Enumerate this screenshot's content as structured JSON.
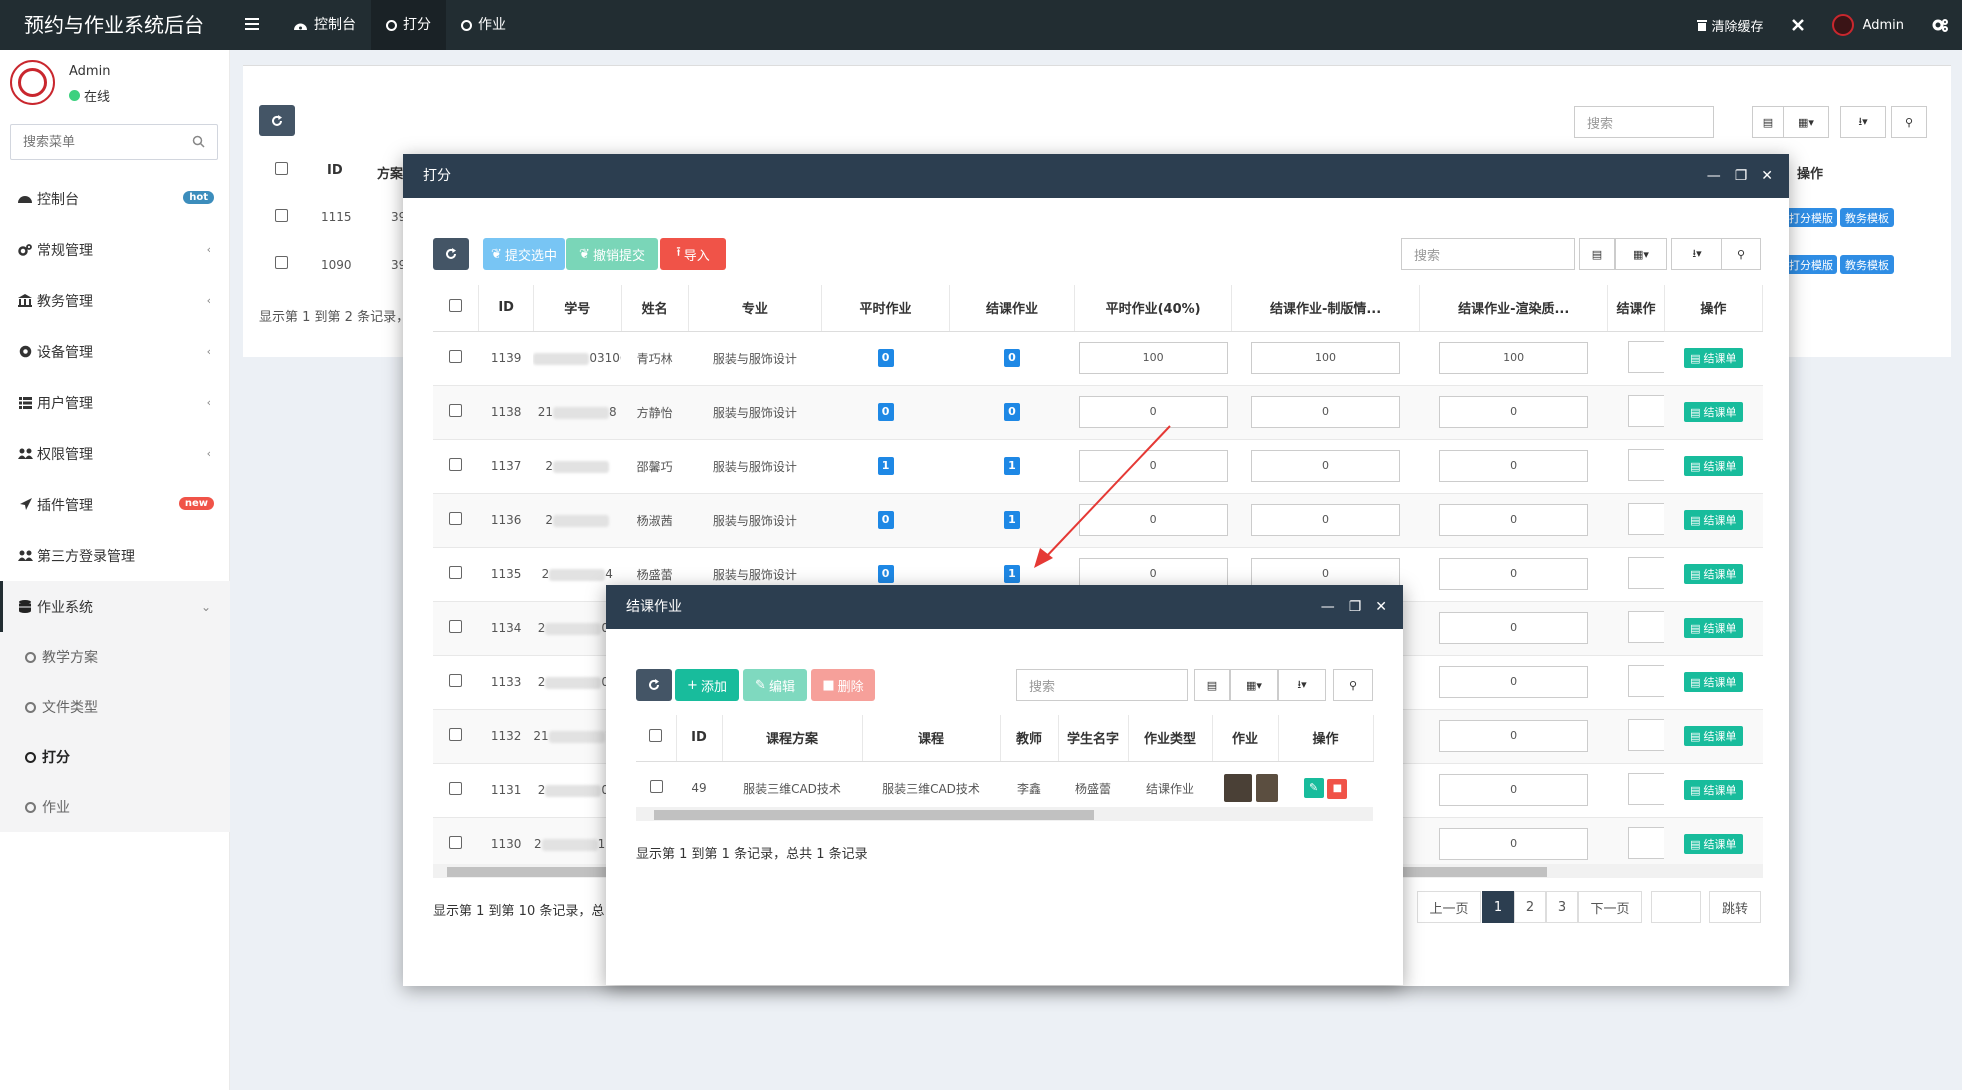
{
  "app": {
    "title": "预约与作业系统后台"
  },
  "topnav": {
    "items": [
      {
        "label": "控制台"
      },
      {
        "label": "打分"
      },
      {
        "label": "作业"
      }
    ],
    "clear_cache": "清除缓存",
    "user": "Admin"
  },
  "sidebar": {
    "user": {
      "name": "Admin",
      "status": "在线"
    },
    "search_placeholder": "搜索菜单",
    "menu": [
      {
        "label": "控制台",
        "badge": "hot",
        "badge_color": "#3c8dbc"
      },
      {
        "label": "常规管理"
      },
      {
        "label": "教务管理"
      },
      {
        "label": "设备管理"
      },
      {
        "label": "用户管理"
      },
      {
        "label": "权限管理"
      },
      {
        "label": "插件管理",
        "badge": "new",
        "badge_color": "#f05348"
      },
      {
        "label": "第三方登录管理"
      },
      {
        "label": "作业系统"
      }
    ],
    "submenu": [
      {
        "label": "教学方案"
      },
      {
        "label": "文件类型"
      },
      {
        "label": "打分"
      },
      {
        "label": "作业"
      }
    ]
  },
  "bg_table": {
    "search_placeholder": "搜索",
    "headers": {
      "id": "ID",
      "plan": "方案",
      "ops": "操作"
    },
    "rows": [
      {
        "id": "1115",
        "plan": "39",
        "b1": "打分模版",
        "b2": "教务模板"
      },
      {
        "id": "1090",
        "plan": "39",
        "b1": "打分模版",
        "b2": "教务模板"
      }
    ],
    "footer": "显示第 1 到第 2 条记录，"
  },
  "score_dialog": {
    "title": "打分",
    "toolbar": {
      "submit": "提交选中",
      "revoke": "撤销提交",
      "import": "导入"
    },
    "search_placeholder": "搜索",
    "headers": [
      "ID",
      "学号",
      "姓名",
      "专业",
      "平时作业",
      "结课作业",
      "平时作业(40%)",
      "结课作业-制版情...",
      "结课作业-渲染质...",
      "结课作",
      "操作"
    ],
    "rows": [
      {
        "id": "1139",
        "sid_pre": "",
        "sid_suf": "031069",
        "name": "青巧林",
        "major": "服装与服饰设计",
        "daily": "0",
        "final": "0",
        "s1": "100",
        "s2": "100",
        "s3": "100",
        "op": "结课单"
      },
      {
        "id": "1138",
        "sid_pre": "21",
        "sid_suf": "8",
        "name": "方静怡",
        "major": "服装与服饰设计",
        "daily": "0",
        "final": "0",
        "s1": "0",
        "s2": "0",
        "s3": "0",
        "op": "结课单"
      },
      {
        "id": "1137",
        "sid_pre": "2",
        "sid_suf": "",
        "name": "邵馨巧",
        "major": "服装与服饰设计",
        "daily": "1",
        "final": "1",
        "s1": "0",
        "s2": "0",
        "s3": "0",
        "op": "结课单"
      },
      {
        "id": "1136",
        "sid_pre": "2",
        "sid_suf": "",
        "name": "杨淑茜",
        "major": "服装与服饰设计",
        "daily": "0",
        "final": "1",
        "s1": "0",
        "s2": "0",
        "s3": "0",
        "op": "结课单"
      },
      {
        "id": "1135",
        "sid_pre": "2",
        "sid_suf": "4",
        "name": "杨盛蕾",
        "major": "服装与服饰设计",
        "daily": "0",
        "final": "1",
        "s1": "0",
        "s2": "0",
        "s3": "0",
        "op": "结课单"
      },
      {
        "id": "1134",
        "sid_pre": "2",
        "sid_suf": "04",
        "s3": "0",
        "op": "结课单"
      },
      {
        "id": "1133",
        "sid_pre": "2",
        "sid_suf": "04",
        "s3": "0",
        "op": "结课单"
      },
      {
        "id": "1132",
        "sid_pre": "21",
        "sid_suf": "103",
        "s3": "0",
        "op": "结课单"
      },
      {
        "id": "1131",
        "sid_pre": "2",
        "sid_suf": "03",
        "s3": "0",
        "op": "结课单"
      },
      {
        "id": "1130",
        "sid_pre": "2",
        "sid_suf": "103",
        "s3": "0",
        "op": "结课单"
      }
    ],
    "footer": "显示第 1 到第 10 条记录，总",
    "pagination": {
      "prev": "上一页",
      "pages": [
        "1",
        "2",
        "3"
      ],
      "next": "下一页",
      "jump": "跳转"
    }
  },
  "final_dialog": {
    "title": "结课作业",
    "toolbar": {
      "add": "添加",
      "edit": "编辑",
      "delete": "删除"
    },
    "search_placeholder": "搜索",
    "headers": [
      "ID",
      "课程方案",
      "课程",
      "教师",
      "学生名字",
      "作业类型",
      "作业",
      "操作"
    ],
    "rows": [
      {
        "id": "49",
        "plan": "服装三维CAD技术",
        "course": "服装三维CAD技术",
        "teacher": "李鑫",
        "student": "杨盛蕾",
        "type": "结课作业"
      }
    ],
    "footer": "显示第 1 到第 1 条记录，总共 1 条记录"
  },
  "colors": {
    "header": "#2c3e50",
    "topbar": "#222d32",
    "primary": "#1e88e5",
    "success": "#18bc9c",
    "danger": "#f05348",
    "arrow": "#e53935"
  }
}
